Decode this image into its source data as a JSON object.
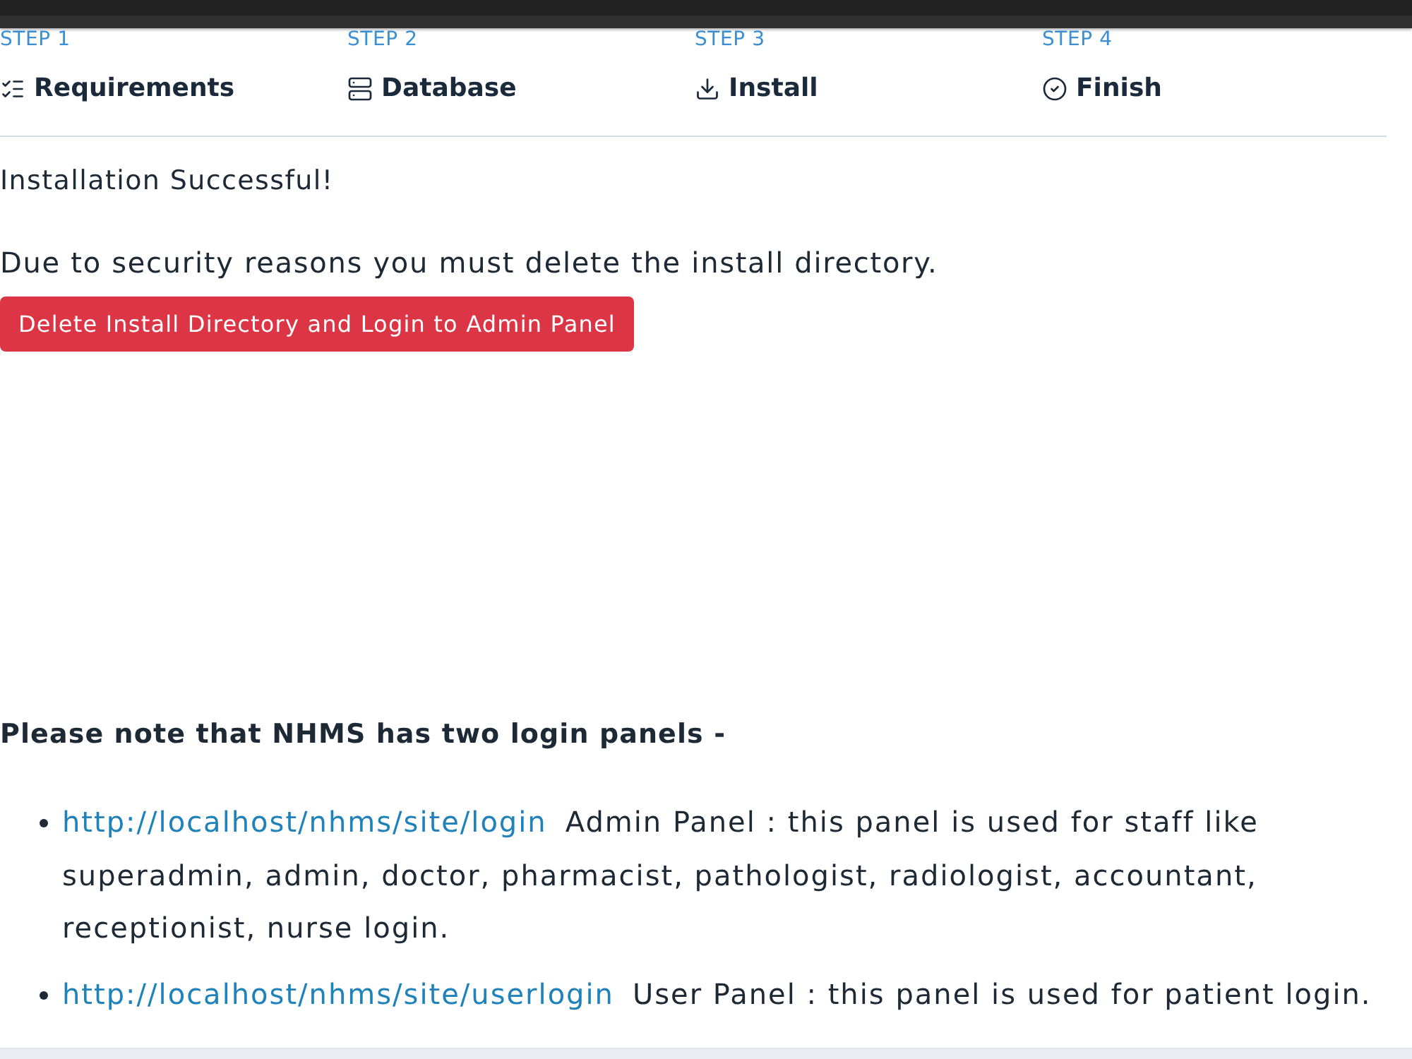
{
  "steps": [
    {
      "label": "STEP 1",
      "title": "Requirements"
    },
    {
      "label": "STEP 2",
      "title": "Database"
    },
    {
      "label": "STEP 3",
      "title": "Install"
    },
    {
      "label": "STEP 4",
      "title": "Finish"
    }
  ],
  "message": "Installation Successful!",
  "warning": "Due to security reasons you must delete the install directory.",
  "delete_button": "Delete Install Directory and Login to Admin Panel",
  "note_heading": "Please note that NHMS has two login panels -",
  "login_panels": [
    {
      "url": "http://localhost/nhms/site/login",
      "description": "Admin Panel : this panel is used for staff like superadmin, admin, doctor, pharmacist, pathologist, radiologist, accountant, receptionist, nurse login."
    },
    {
      "url": "http://localhost/nhms/site/userlogin",
      "description": "User Panel : this panel is used for patient login."
    }
  ]
}
